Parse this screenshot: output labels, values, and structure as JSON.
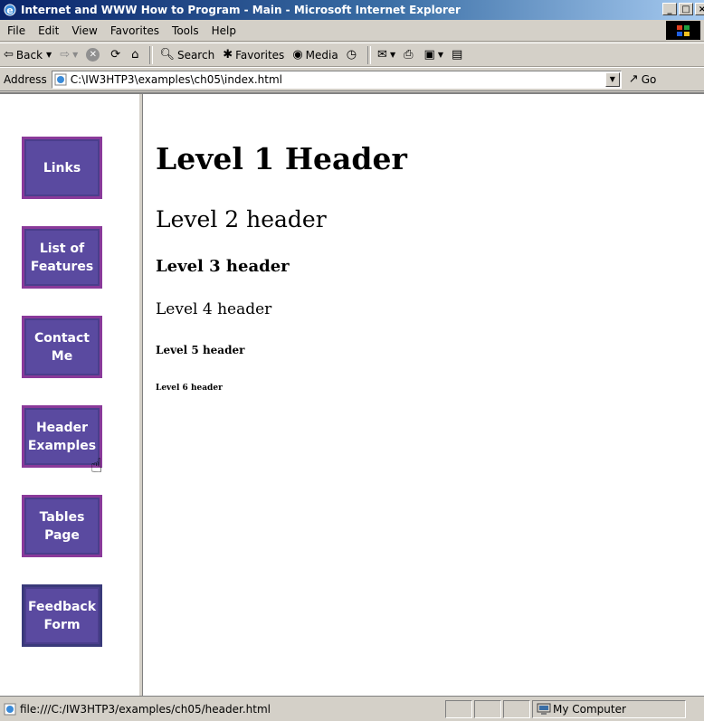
{
  "window": {
    "title": "Internet and WWW How to Program - Main - Microsoft Internet Explorer",
    "controls": [
      "_",
      "□",
      "×"
    ]
  },
  "menu": [
    "File",
    "Edit",
    "View",
    "Favorites",
    "Tools",
    "Help"
  ],
  "toolbar": {
    "back": "Back",
    "search": "Search",
    "favorites": "Favorites",
    "media": "Media"
  },
  "address": {
    "label": "Address",
    "value": "C:\\IW3HTP3\\examples\\ch05\\index.html",
    "go": "Go"
  },
  "nav": [
    {
      "label": "Links"
    },
    {
      "label": "List of\nFeatures"
    },
    {
      "label": "Contact\nMe"
    },
    {
      "label": "Header\nExamples"
    },
    {
      "label": "Tables\nPage"
    },
    {
      "label": "Feedback\nForm"
    }
  ],
  "headers": {
    "h1": "Level 1 Header",
    "h2": "Level 2 header",
    "h3": "Level 3 header",
    "h4": "Level 4 header",
    "h5": "Level 5 header",
    "h6": "Level 6 header"
  },
  "status": {
    "url": "file:///C:/IW3HTP3/examples/ch05/header.html",
    "zone": "My Computer"
  }
}
